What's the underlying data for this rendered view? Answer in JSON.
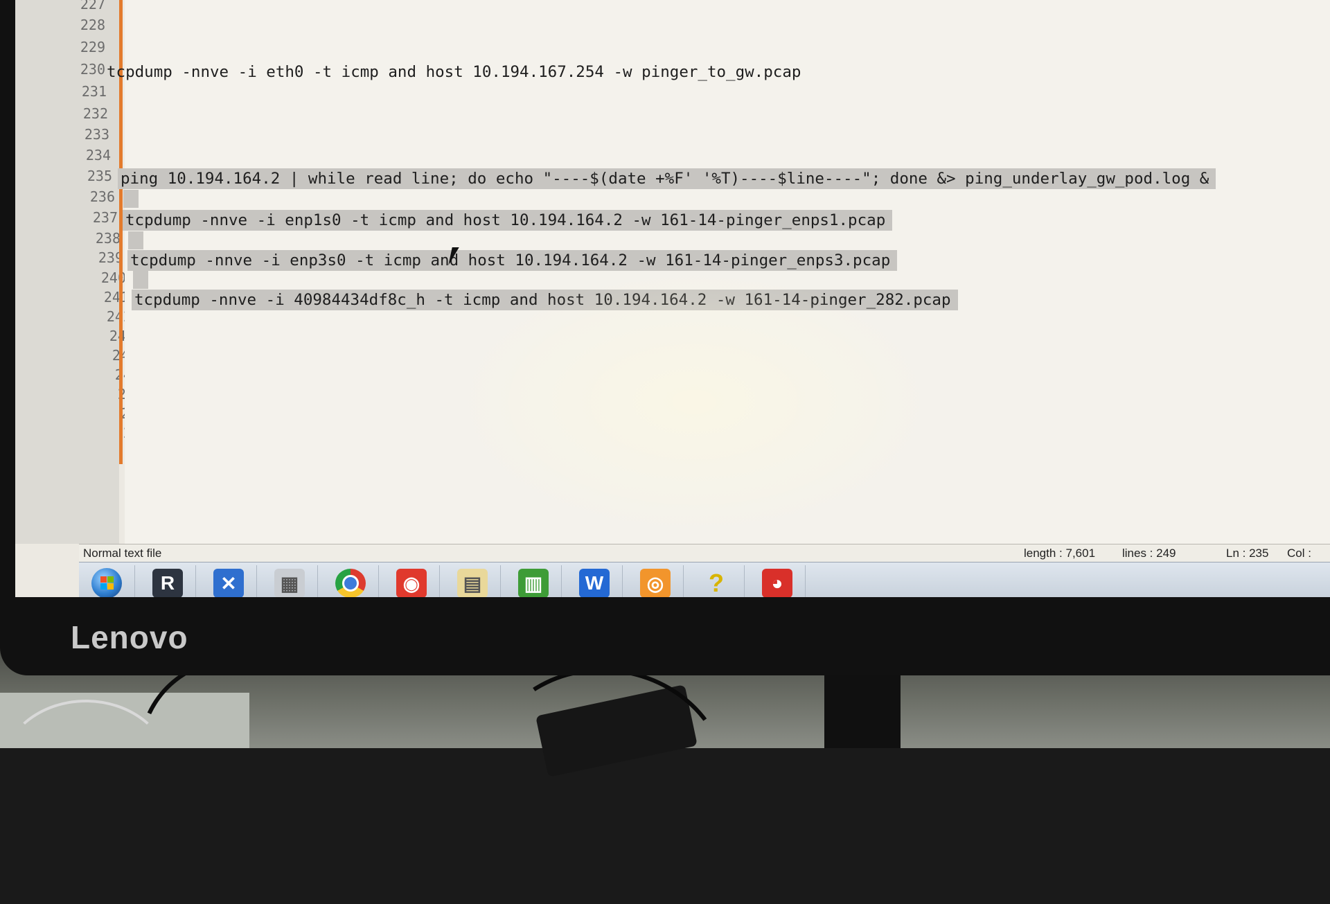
{
  "bezel": {
    "brand": "Lenovo"
  },
  "editor": {
    "lines": [
      {
        "num": "227",
        "text": ""
      },
      {
        "num": "228",
        "text": ""
      },
      {
        "num": "229",
        "text": ""
      },
      {
        "num": "230",
        "text": "tcpdump -nnve -i eth0 -t icmp and host 10.194.167.254 -w pinger_to_gw.pcap"
      },
      {
        "num": "231",
        "text": ""
      },
      {
        "num": "232",
        "text": ""
      },
      {
        "num": "233",
        "text": ""
      },
      {
        "num": "234",
        "text": ""
      },
      {
        "num": "235",
        "text": "ping 10.194.164.2 | while read line; do echo \"----$(date +%F' '%T)----$line----\"; done &> ping_underlay_gw_pod.log &",
        "selected": true
      },
      {
        "num": "236",
        "text": "",
        "selected": true
      },
      {
        "num": "237",
        "text": "tcpdump -nnve -i enp1s0 -t icmp and host 10.194.164.2 -w 161-14-pinger_enps1.pcap",
        "selected": true
      },
      {
        "num": "238",
        "text": "",
        "selected": true
      },
      {
        "num": "239",
        "text": "tcpdump -nnve -i enp3s0 -t icmp and host 10.194.164.2 -w 161-14-pinger_enps3.pcap",
        "selected": true
      },
      {
        "num": "240",
        "text": "",
        "selected": true
      },
      {
        "num": "241",
        "text": "tcpdump -nnve -i 40984434df8c_h -t icmp and host 10.194.164.2 -w 161-14-pinger_282.pcap",
        "selected": true
      },
      {
        "num": "242",
        "text": ""
      },
      {
        "num": "243",
        "text": ""
      },
      {
        "num": "244",
        "text": ""
      },
      {
        "num": "245",
        "text": ""
      },
      {
        "num": "246",
        "text": ""
      },
      {
        "num": "247",
        "text": ""
      },
      {
        "num": "248",
        "text": ""
      },
      {
        "num": "249",
        "text": ""
      }
    ]
  },
  "statusbar": {
    "file_type": "Normal text file",
    "length": "length : 7,601",
    "lines": "lines : 249",
    "ln": "Ln : 235",
    "col": "Col :"
  },
  "taskbar": {
    "items": [
      {
        "icon": "windows-start-icon",
        "color": "#2f7fd1"
      },
      {
        "icon": "r-app-icon",
        "glyph": "R",
        "color": "#2d3440"
      },
      {
        "icon": "x-app-icon",
        "glyph": "✕",
        "color": "#2f6fcf"
      },
      {
        "icon": "calculator-icon",
        "glyph": "▦",
        "color": "#c9cdd2"
      },
      {
        "icon": "chrome-icon",
        "color": "#dd3b2f"
      },
      {
        "icon": "swirl-app-icon",
        "glyph": "◉",
        "color": "#e0392d"
      },
      {
        "icon": "file-manager-icon",
        "glyph": "▤",
        "color": "#e9d89a"
      },
      {
        "icon": "chart-app-icon",
        "glyph": "▥",
        "color": "#3e9c37"
      },
      {
        "icon": "wps-writer-icon",
        "glyph": "W",
        "color": "#2469d4"
      },
      {
        "icon": "orange-app-icon",
        "glyph": "◎",
        "color": "#f2952c"
      },
      {
        "icon": "help-icon",
        "glyph": "?",
        "color": "#d8b400"
      },
      {
        "icon": "pie-app-icon",
        "glyph": "◕",
        "color": "#d9302a"
      }
    ]
  }
}
